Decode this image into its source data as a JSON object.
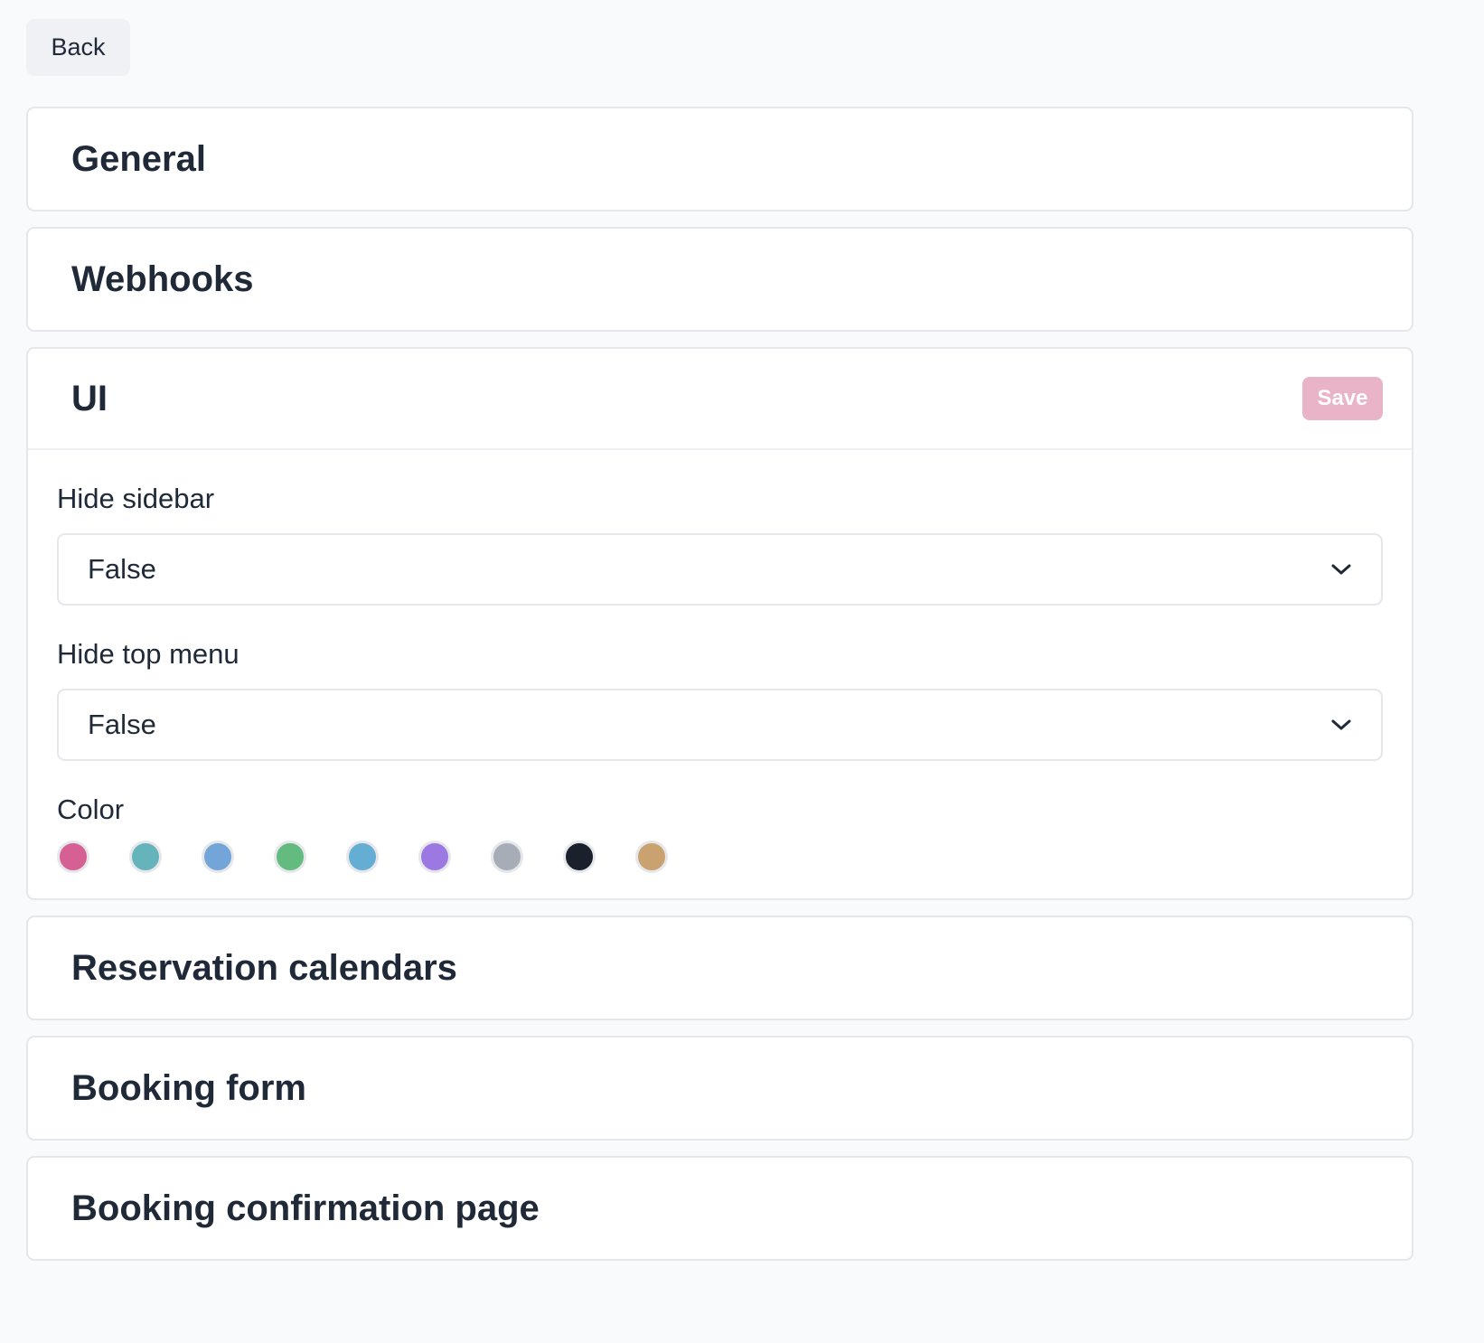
{
  "back_label": "Back",
  "sections": {
    "general": {
      "title": "General"
    },
    "webhooks": {
      "title": "Webhooks"
    },
    "ui": {
      "title": "UI",
      "save_label": "Save",
      "hide_sidebar": {
        "label": "Hide sidebar",
        "value": "False"
      },
      "hide_top_menu": {
        "label": "Hide top menu",
        "value": "False"
      },
      "color": {
        "label": "Color",
        "swatches": [
          "#d65f93",
          "#66b4bb",
          "#74a5d8",
          "#63bb80",
          "#64aed4",
          "#9c78e3",
          "#a7adb7",
          "#1a202c",
          "#c9a26f"
        ]
      }
    },
    "reservation_calendars": {
      "title": "Reservation calendars"
    },
    "booking_form": {
      "title": "Booking form"
    },
    "booking_confirmation": {
      "title": "Booking confirmation page"
    }
  }
}
